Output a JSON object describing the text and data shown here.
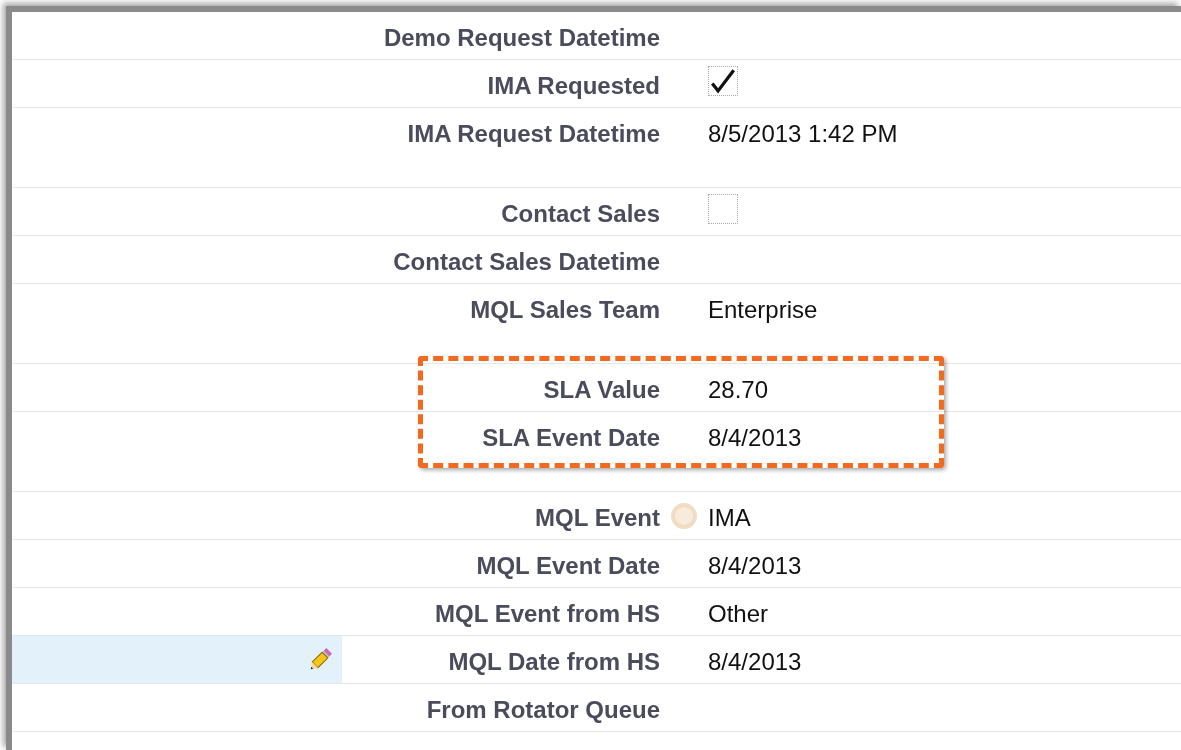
{
  "rows": [
    {
      "label": "Demo Request Datetime",
      "kind": "text",
      "help": false,
      "hovered": false,
      "highlighted": false
    },
    {
      "label": "IMA Requested",
      "kind": "checkbox",
      "checked": true,
      "help": false,
      "hovered": false,
      "highlighted": false
    },
    {
      "label": "IMA Request Datetime",
      "kind": "text",
      "value": "8/5/2013 1:42 PM",
      "help": false,
      "hovered": false,
      "highlighted": false
    },
    {
      "label": "Contact Sales",
      "kind": "checkbox",
      "checked": false,
      "help": false,
      "hovered": false,
      "highlighted": false
    },
    {
      "label": "Contact Sales Datetime",
      "kind": "text",
      "help": false,
      "hovered": false,
      "highlighted": false
    },
    {
      "label": "MQL Sales Team",
      "kind": "text",
      "value": "Enterprise",
      "help": false,
      "hovered": false,
      "highlighted": false
    },
    {
      "label": "SLA Value",
      "kind": "text",
      "value": "28.70",
      "help": false,
      "hovered": false,
      "highlighted": true
    },
    {
      "label": "SLA Event Date",
      "kind": "text",
      "value": "8/4/2013",
      "help": false,
      "hovered": false,
      "highlighted": true
    },
    {
      "label": "MQL Event",
      "kind": "text",
      "value": "IMA",
      "help": true,
      "hovered": false,
      "highlighted": false
    },
    {
      "label": "MQL Event Date",
      "kind": "text",
      "value": "8/4/2013",
      "help": false,
      "hovered": false,
      "highlighted": false
    },
    {
      "label": "MQL Event from HS",
      "kind": "text",
      "value": "Other",
      "help": false,
      "hovered": false,
      "highlighted": false
    },
    {
      "label": "MQL Date from HS",
      "kind": "text",
      "value": "8/4/2013",
      "help": false,
      "hovered": true,
      "highlighted": false
    },
    {
      "label": "From Rotator Queue",
      "kind": "text",
      "help": false,
      "hovered": false,
      "highlighted": false
    }
  ]
}
